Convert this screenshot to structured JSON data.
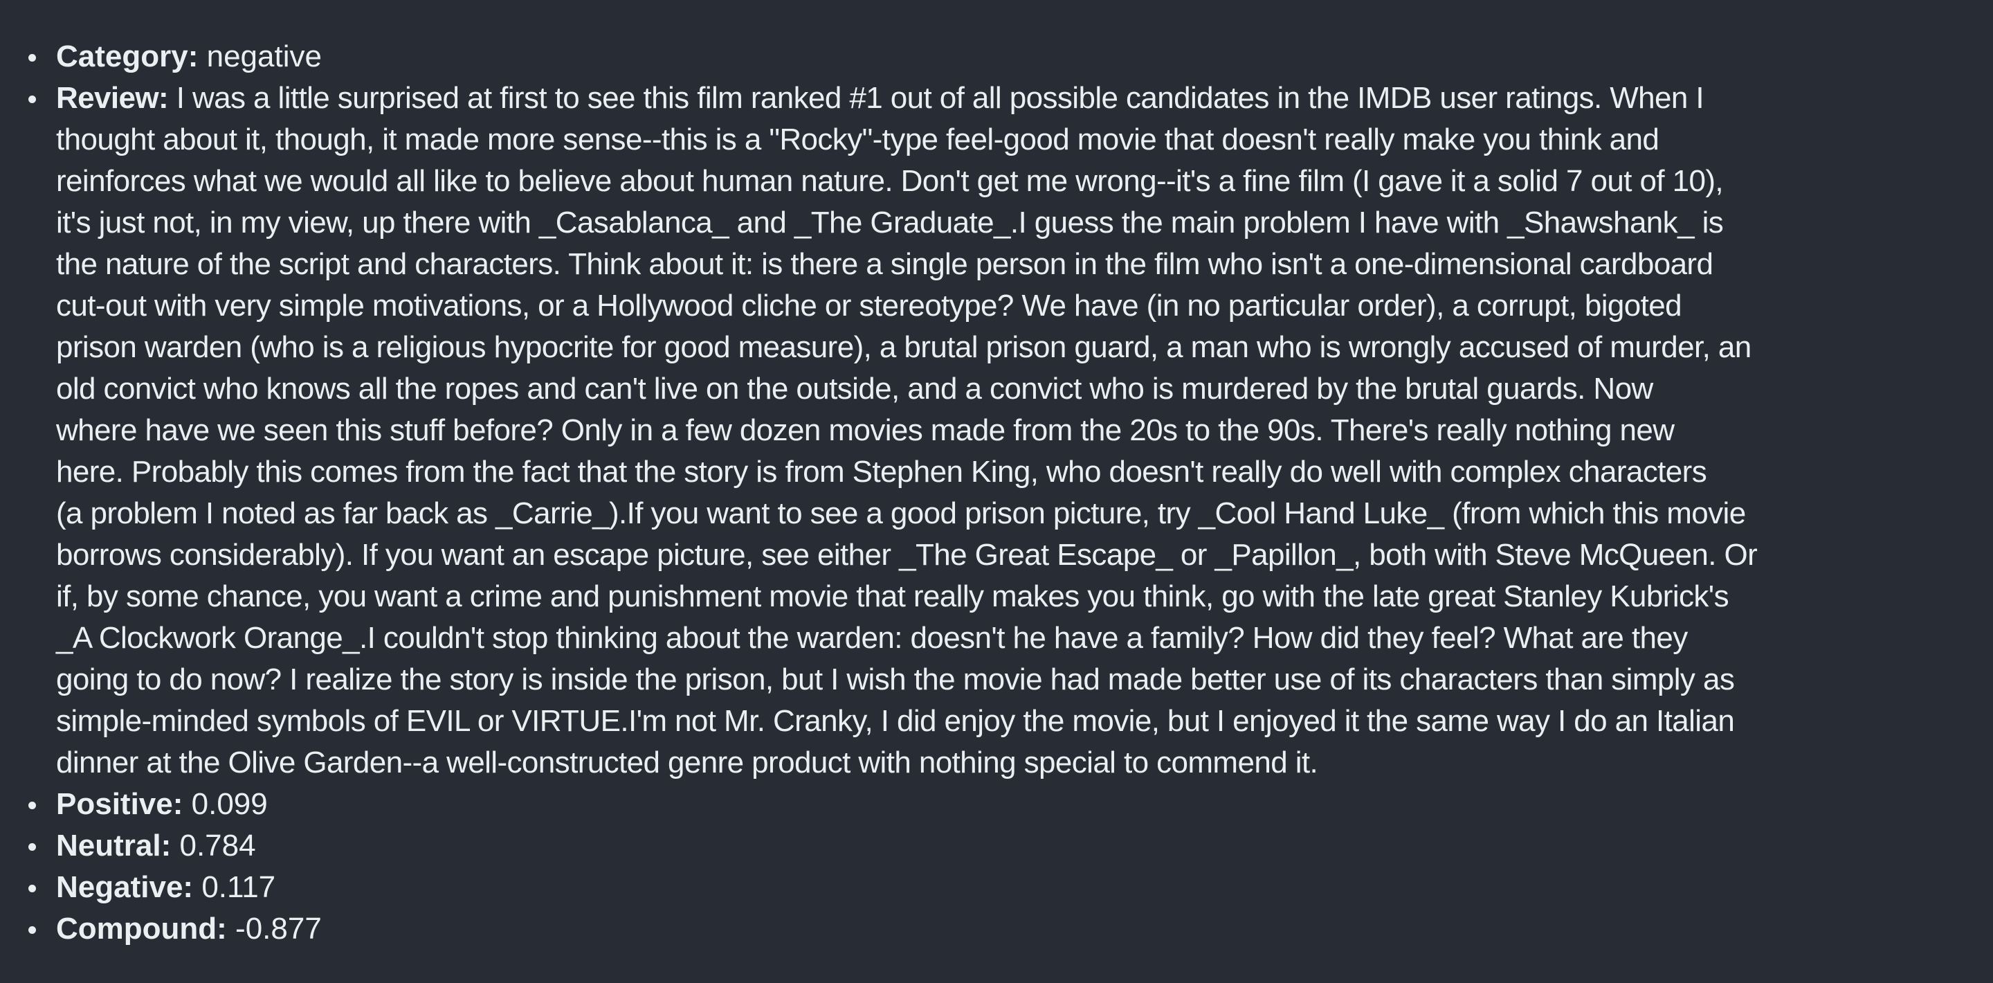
{
  "items": {
    "category": {
      "label": "Category:",
      "value": "negative"
    },
    "review": {
      "label": "Review:",
      "lines": [
        "I was a little surprised at first to see this film ranked #1 out of all possible candidates in the IMDB user ratings. When I",
        "thought about it, though, it made more sense--this is a \"Rocky\"-type feel-good movie that doesn't really make you think and",
        "reinforces what we would all like to believe about human nature. Don't get me wrong--it's a fine film (I gave it a solid 7 out of 10),",
        "it's just not, in my view, up there with _Casablanca_ and _The Graduate_.I guess the main problem I have with _Shawshank_ is",
        "the nature of the script and characters. Think about it: is there a single person in the film who isn't a one-dimensional cardboard",
        "cut-out with very simple motivations, or a Hollywood cliche or stereotype? We have (in no particular order), a corrupt, bigoted",
        "prison warden (who is a religious hypocrite for good measure), a brutal prison guard, a man who is wrongly accused of murder, an",
        "old convict who knows all the ropes and can't live on the outside, and a convict who is murdered by the brutal guards. Now",
        "where have we seen this stuff before? Only in a few dozen movies made from the 20s to the 90s. There's really nothing new",
        "here. Probably this comes from the fact that the story is from Stephen King, who doesn't really do well with complex characters",
        "(a problem I noted as far back as _Carrie_).If you want to see a good prison picture, try _Cool Hand Luke_ (from which this movie",
        "borrows considerably). If you want an escape picture, see either _The Great Escape_ or _Papillon_, both with Steve McQueen. Or",
        "if, by some chance, you want a crime and punishment movie that really makes you think, go with the late great Stanley Kubrick's",
        "_A Clockwork Orange_.I couldn't stop thinking about the warden: doesn't he have a family? How did they feel? What are they",
        "going to do now? I realize the story is inside the prison, but I wish the movie had made better use of its characters than simply as",
        "simple-minded symbols of EVIL or VIRTUE.I'm not Mr. Cranky, I did enjoy the movie, but I enjoyed it the same way I do an Italian",
        "dinner at the Olive Garden--a well-constructed genre product with nothing special to commend it."
      ]
    },
    "positive": {
      "label": "Positive:",
      "value": "0.099"
    },
    "neutral": {
      "label": "Neutral:",
      "value": "0.784"
    },
    "negative": {
      "label": "Negative:",
      "value": "0.117"
    },
    "compound": {
      "label": "Compound:",
      "value": "-0.877"
    }
  },
  "colors": {
    "background": "#282c34",
    "text": "#eceff2"
  }
}
